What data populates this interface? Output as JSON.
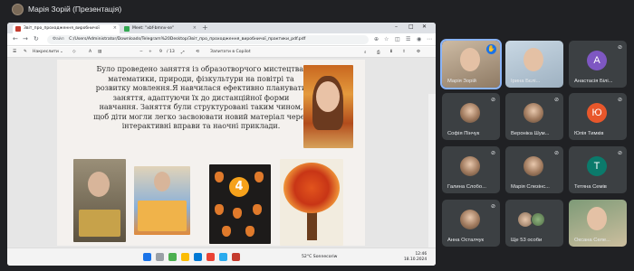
{
  "presenter": {
    "name": "Марія Зорій (Презентація)"
  },
  "browser": {
    "tabs": [
      {
        "label": "Звіт_про_проходження_виробничої",
        "active": true
      },
      {
        "label": "Meet: \"xbf-bmnv-se\"",
        "active": false
      }
    ],
    "address_label": "Файл",
    "address": "C:/Users/Administrator/Downloads/Telegram%20Desktop/Звіт_про_проходження_виробничої_практики_pdf.pdf"
  },
  "pdf_toolbar": {
    "draw": "Накреслити",
    "page_current": "9",
    "page_total": "/ 13",
    "copilot": "Запитати в Copilot"
  },
  "document": {
    "text": "Було проведено заняття із образотворчого мистецтва, математики, природи, фізкультури на повітрі та розвитку мовлення.Я навчилася ефективно планувати заняття, адаптуючи їх до дистанційної форми навчання. Заняття були структуровані таким чином, щоб діти могли легко засвоювати новий матеріал через інтерактивні вправи та наочні приклади.",
    "number_badge": "4"
  },
  "taskbar": {
    "weather": "52°C  Sonnecoriw",
    "time": "12:46",
    "date": "18.10.2024"
  },
  "participants": [
    {
      "name": "Марія Зорій",
      "type": "video",
      "hand": true
    },
    {
      "name": "Ірина Бєлі...",
      "type": "video"
    },
    {
      "name": "Анастасія Білі...",
      "type": "letter",
      "letter": "А",
      "color": "#7e57c2"
    },
    {
      "name": "Софія Пінчук",
      "type": "photo"
    },
    {
      "name": "Вероніка Шум...",
      "type": "photo"
    },
    {
      "name": "Юлія Тимків",
      "type": "letter",
      "letter": "Ю",
      "color": "#e8572b"
    },
    {
      "name": "Галина Слобо...",
      "type": "photo"
    },
    {
      "name": "Марія Слезінс...",
      "type": "photo"
    },
    {
      "name": "Тетяна Семів",
      "type": "letter",
      "letter": "Т",
      "color": "#0b7a6b"
    },
    {
      "name": "Анна Осталчук",
      "type": "photo"
    },
    {
      "name": "Ще 53 особи",
      "type": "more"
    },
    {
      "name": "Оксана Селе...",
      "type": "video"
    }
  ]
}
